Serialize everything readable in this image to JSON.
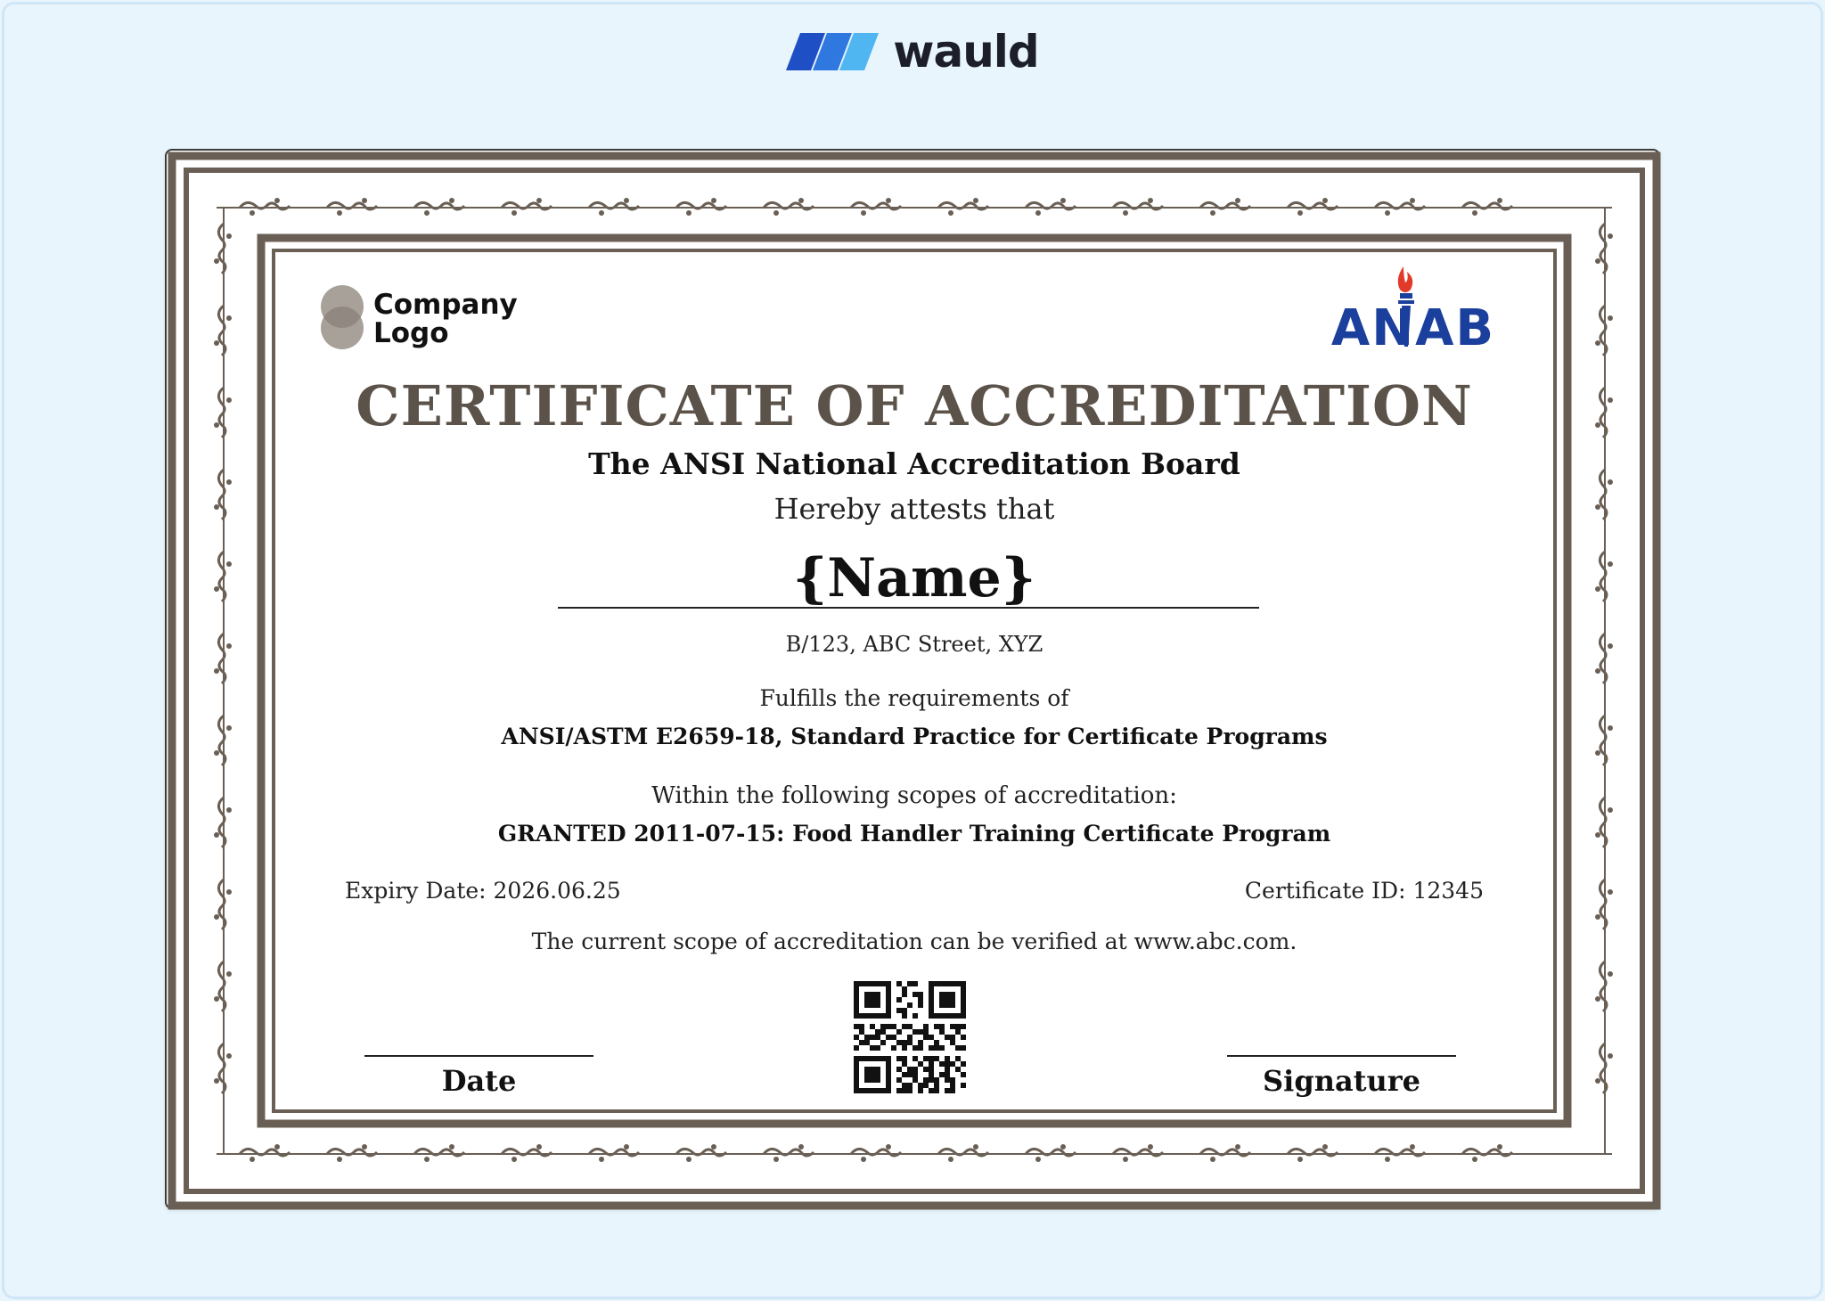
{
  "brand": {
    "name": "wauld",
    "colors": {
      "dark_blue": "#1f4fc4",
      "light_blue": "#4fb6f2",
      "text": "#1c1f2a"
    }
  },
  "certificate": {
    "company_logo_text": [
      "Company",
      "Logo"
    ],
    "accreditor_logo_text": "ANAB",
    "title": "CERTIFICATE OF ACCREDITATION",
    "issuer": "The ANSI National Accreditation Board",
    "attests": "Hereby attests that",
    "name": "{Name}",
    "address": "B/123, ABC Street, XYZ",
    "fulfills_label": "Fulfills the requirements of",
    "standard": "ANSI/ASTM E2659-18, Standard Practice for Certificate Programs",
    "scopes_label": "Within the following scopes of accreditation:",
    "granted": "GRANTED 2011-07-15: Food Handler Training Certificate Program",
    "expiry": "Expiry Date: 2026.06.25",
    "certificate_id": "Certificate ID: 12345",
    "verify_text": "The current scope of accreditation can be verified at www.abc.com.",
    "date_label": "Date",
    "signature_label": "Signature"
  },
  "colors": {
    "page_background": "#e9f5fd",
    "frame": "#6a5f55",
    "title": "#5b5249",
    "anab_blue": "#1b3f9c",
    "anab_flame": "#e23a2a"
  }
}
